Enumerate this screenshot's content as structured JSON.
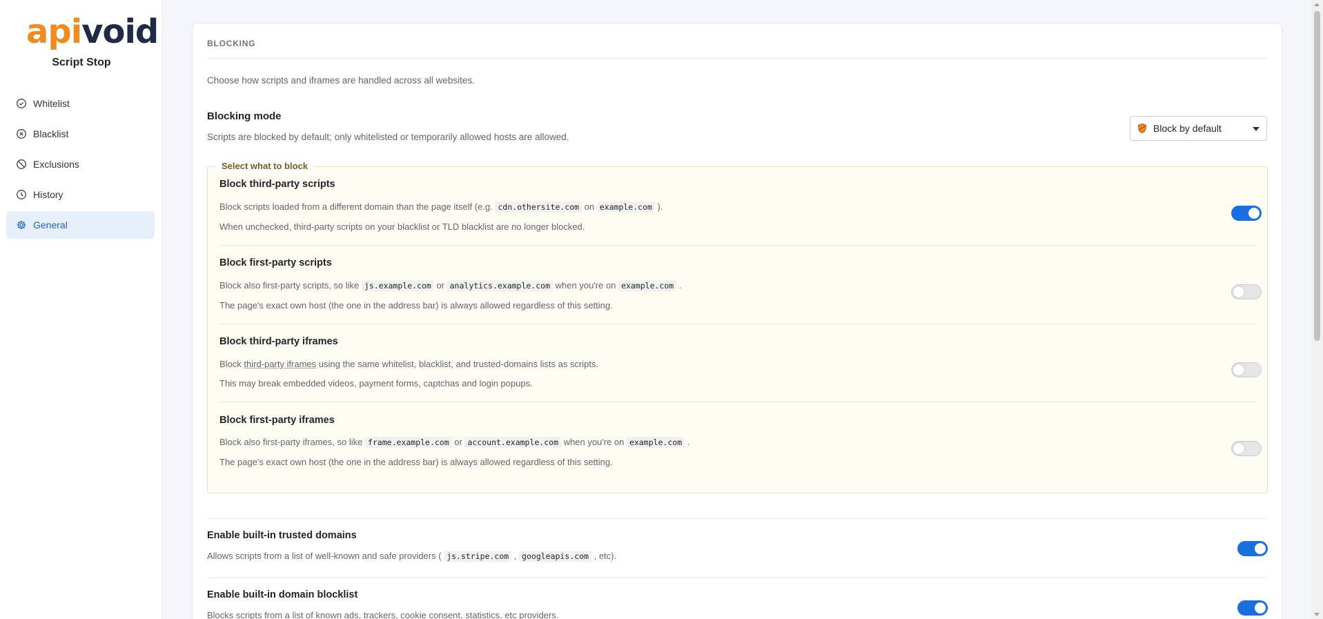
{
  "brand": {
    "logo_api": "api",
    "logo_void": "void",
    "app_name": "Script Stop"
  },
  "sidebar": {
    "items": [
      {
        "label": "Whitelist",
        "icon": "check-circle-icon",
        "active": false
      },
      {
        "label": "Blacklist",
        "icon": "x-circle-icon",
        "active": false
      },
      {
        "label": "Exclusions",
        "icon": "ban-icon",
        "active": false
      },
      {
        "label": "History",
        "icon": "clock-icon",
        "active": false
      },
      {
        "label": "General",
        "icon": "gear-icon",
        "active": true
      }
    ]
  },
  "section": {
    "title": "BLOCKING",
    "description": "Choose how scripts and iframes are handled across all websites."
  },
  "mode": {
    "title": "Blocking mode",
    "description": "Scripts are blocked by default; only whitelisted or temporarily allowed hosts are allowed.",
    "selected": "Block by default",
    "icon": "shield-icon"
  },
  "group": {
    "legend": "Select what to block",
    "options": [
      {
        "title": "Block third-party scripts",
        "line1": {
          "pre": "Block scripts loaded from a different domain than the page itself (e.g. ",
          "code1": "cdn.othersite.com",
          "mid": " on ",
          "code2": "example.com",
          "post": " )."
        },
        "line2": "When unchecked, third-party scripts on your blacklist or TLD blacklist are no longer blocked.",
        "enabled": true
      },
      {
        "title": "Block first-party scripts",
        "line1": {
          "pre": "Block also first-party scripts, so like ",
          "code1": "js.example.com",
          "mid": " or ",
          "code2": "analytics.example.com",
          "mid2": " when you're on ",
          "code3": "example.com",
          "post": " ."
        },
        "line2": "The page's exact own host (the one in the address bar) is always allowed regardless of this setting.",
        "enabled": false
      },
      {
        "title": "Block third-party iframes",
        "line1": {
          "pre": "Block ",
          "underlined": "third-party iframes",
          "post": " using the same whitelist, blacklist, and trusted-domains lists as scripts."
        },
        "line2": "This may break embedded videos, payment forms, captchas and login popups.",
        "enabled": false
      },
      {
        "title": "Block first-party iframes",
        "line1": {
          "pre": "Block also first-party iframes, so like ",
          "code1": "frame.example.com",
          "mid": " or ",
          "code2": "account.example.com",
          "mid2": " when you're on ",
          "code3": "example.com",
          "post": " ."
        },
        "line2": "The page's exact own host (the one in the address bar) is always allowed regardless of this setting.",
        "enabled": false
      }
    ]
  },
  "trusted": {
    "title": "Enable built-in trusted domains",
    "desc": {
      "pre": "Allows scripts from a list of well-known and safe providers ( ",
      "code1": "js.stripe.com",
      "mid": " , ",
      "code2": "googleapis.com",
      "post": " , etc)."
    },
    "enabled": true
  },
  "blocklist": {
    "title": "Enable built-in domain blocklist",
    "desc": "Blocks scripts from a list of known ads, trackers, cookie consent, statistics, etc providers.",
    "enabled": true
  },
  "colors": {
    "accent": "#1a6fe0",
    "brand_orange": "#f08c1f",
    "brand_navy": "#1f2a44",
    "group_bg": "#fffcf3"
  }
}
